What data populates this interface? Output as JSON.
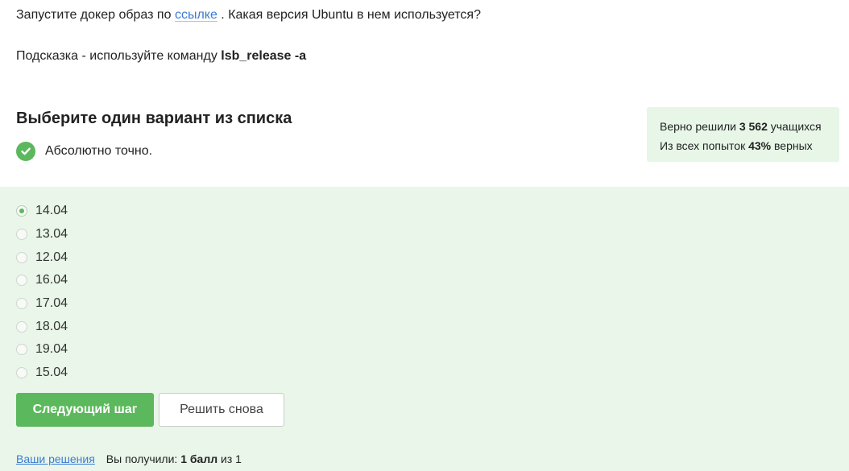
{
  "question": {
    "line1_before": "Запустите докер образ по ",
    "link_text": "ссылке",
    "line1_after": " . Какая версия Ubuntu в нем используется?",
    "hint_prefix": "Подсказка - используйте команду ",
    "hint_command": "lsb_release -a"
  },
  "task": {
    "heading": "Выберите один вариант из списка",
    "result_text": "Абсолютно точно."
  },
  "stats": {
    "line1_prefix": "Верно решили ",
    "solved_count": "3 562",
    "line1_suffix": " учащихся",
    "line2_prefix": "Из всех попыток ",
    "percent": "43%",
    "line2_suffix": " верных"
  },
  "options": [
    {
      "label": "14.04",
      "selected": true
    },
    {
      "label": "13.04",
      "selected": false
    },
    {
      "label": "12.04",
      "selected": false
    },
    {
      "label": "16.04",
      "selected": false
    },
    {
      "label": "17.04",
      "selected": false
    },
    {
      "label": "18.04",
      "selected": false
    },
    {
      "label": "19.04",
      "selected": false
    },
    {
      "label": "15.04",
      "selected": false
    }
  ],
  "buttons": {
    "next_label": "Следующий шаг",
    "retry_label": "Решить снова"
  },
  "footer": {
    "solutions_link": "Ваши решения",
    "received_prefix": "Вы получили: ",
    "score": "1 балл",
    "received_suffix": " из 1"
  },
  "colors": {
    "accent_green": "#5cb85c",
    "answer_bg": "#e9f6e9",
    "link_blue": "#3a7bd5"
  },
  "icons": {
    "result": "check-circle-icon"
  }
}
